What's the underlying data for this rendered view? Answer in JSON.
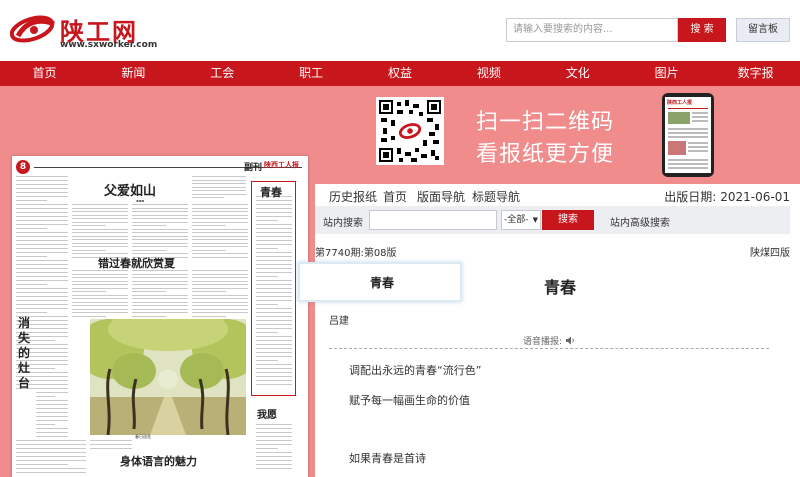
{
  "header": {
    "logo_text": "陕工网",
    "logo_url": "www.sxworker.com",
    "search_placeholder": "请输入要搜索的内容...",
    "search_button": "搜 索",
    "message_board": "留言板"
  },
  "nav": [
    "首页",
    "新闻",
    "工会",
    "职工",
    "权益",
    "视频",
    "文化",
    "图片",
    "数字报"
  ],
  "banner": {
    "line1": "扫一扫二维码",
    "line2": "看报纸更方便",
    "phone_title": "陕西工人报"
  },
  "newspaper": {
    "page_number": "8",
    "section": "副刊",
    "brand": "陕西工人报",
    "headline1": "父爱如山",
    "headline2": "错过春就欣赏夏",
    "headline3": "身体语言的魅力",
    "vertical_title": "消失的灶台",
    "sidebar_title1": "青春",
    "sidebar_title2": "我愿",
    "photo_caption": "春日迎花"
  },
  "panel": {
    "tabs": [
      "历史报纸",
      "首页",
      "版面导航",
      "标题导航"
    ],
    "pub_date_label": "出版日期:",
    "pub_date": "2021-06-01",
    "search_label": "站内搜索",
    "select_value": "-全部-",
    "search_button": "搜索",
    "advanced_search": "站内高级搜索",
    "issue": "第7740期:第08版",
    "edition": "陕煤四版",
    "article_title": "青春",
    "author": "吕建",
    "voice_label": "语音播报:",
    "paragraphs": [
      "调配出永远的青春“流行色”",
      "赋予每一幅画生命的价值",
      "如果青春是首诗"
    ]
  },
  "overlay": {
    "text": "青春"
  },
  "colors": {
    "brand_red": "#c8161d",
    "banner_pink": "#f08c8c"
  }
}
